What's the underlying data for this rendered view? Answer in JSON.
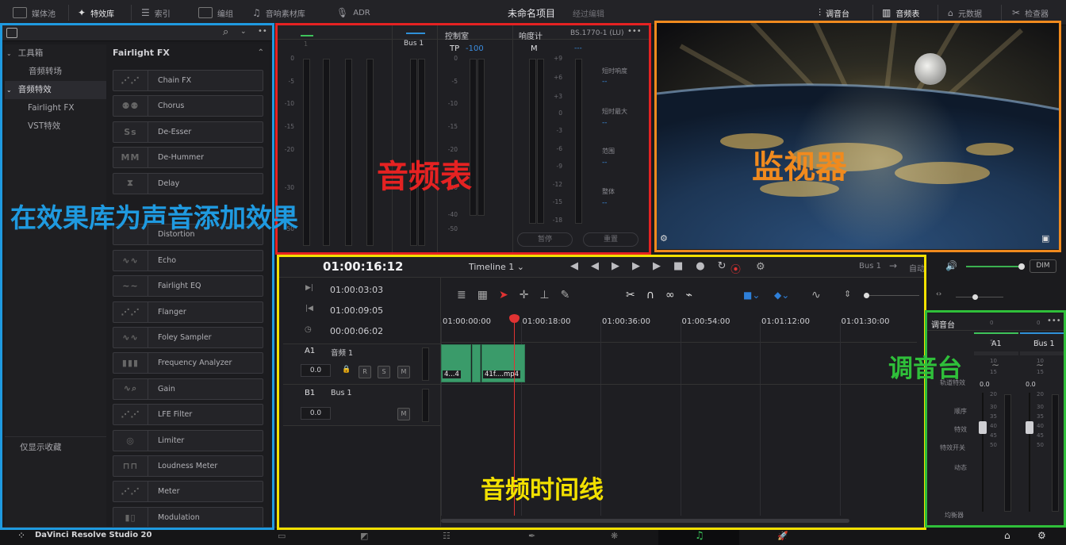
{
  "topbar": {
    "media_pool": "媒体池",
    "effects_library": "特效库",
    "index": "索引",
    "edit_index": "编组",
    "sound_library": "音响素材库",
    "adr": "ADR",
    "project_name": "未命名项目",
    "status": "经过编辑",
    "mixer": "调音台",
    "meters": "音频表",
    "metadata": "元数据",
    "inspector": "检查器"
  },
  "left": {
    "tree": [
      "工具箱",
      "音频转场",
      "音频特效",
      "Fairlight FX",
      "VST特效"
    ],
    "favorites": "仅显示收藏",
    "fx_header": "Fairlight FX",
    "fx": [
      "Chain FX",
      "Chorus",
      "De-Esser",
      "De-Hummer",
      "Delay",
      "Distortion",
      "Echo",
      "Fairlight EQ",
      "Flanger",
      "Foley Sampler",
      "Frequency Analyzer",
      "Gain",
      "LFE Filter",
      "Limiter",
      "Loudness Meter",
      "Meter",
      "Modulation"
    ]
  },
  "meters": {
    "bus": "Bus 1",
    "control_room": "控制室",
    "tp": "TP",
    "tp_value": "-100",
    "loudness": "响度计",
    "standard": "BS.1770-1 (LU)",
    "m": "M",
    "m_value": "---",
    "short_loud": "短时响度",
    "short_max": "短时最大",
    "range": "范围",
    "integrated": "整体",
    "dash": "--",
    "pause": "暂停",
    "reset": "重置",
    "channel": "1",
    "scale_left": [
      "0",
      "-5",
      "-10",
      "-15",
      "-20",
      "-30",
      "-40",
      "-50"
    ],
    "scale_right": [
      "+9",
      "+6",
      "+3",
      "0",
      "-3",
      "-6",
      "-9",
      "-12",
      "-15",
      "-18"
    ]
  },
  "timeline": {
    "timecode": "01:00:16:12",
    "name": "Timeline 1",
    "bus": "Bus 1",
    "auto": "自动",
    "in": "01:00:03:03",
    "out": "01:00:09:05",
    "dur": "00:00:06:02",
    "ruler": [
      "01:00:00:00",
      "01:00:18:00",
      "01:00:36:00",
      "01:00:54:00",
      "01:01:12:00",
      "01:01:30:00"
    ],
    "track_a1": "A1",
    "track_a1_name": "音频 1",
    "track_b1": "B1",
    "track_b1_name": "Bus 1",
    "vol": "0.0",
    "r": "R",
    "s": "S",
    "mbtn": "M",
    "clip1": "4...4",
    "clip2": "41f....mp4",
    "dim": "DIM"
  },
  "mixer": {
    "title": "调音台",
    "a1": "A1",
    "bus1": "Bus 1",
    "rows": [
      "轨道特效",
      "顺序",
      "特效",
      "特效开关",
      "动态",
      "均衡器"
    ],
    "vol": "0.0",
    "scale": [
      "0",
      "5",
      "10",
      "15",
      "20",
      "30",
      "35",
      "40",
      "45",
      "50"
    ]
  },
  "overlays": {
    "meters": "音频表",
    "viewer": "监视器",
    "effects": "在效果库为声音添加效果",
    "timeline": "音频时间线",
    "mixer": "调音台"
  },
  "footer": {
    "app": "DaVinci Resolve Studio 20"
  },
  "colors": {
    "blue": "#1f9ae0",
    "red": "#e52222",
    "orange": "#f08a1e",
    "yellow": "#f2e000",
    "green": "#2fbf3a"
  }
}
